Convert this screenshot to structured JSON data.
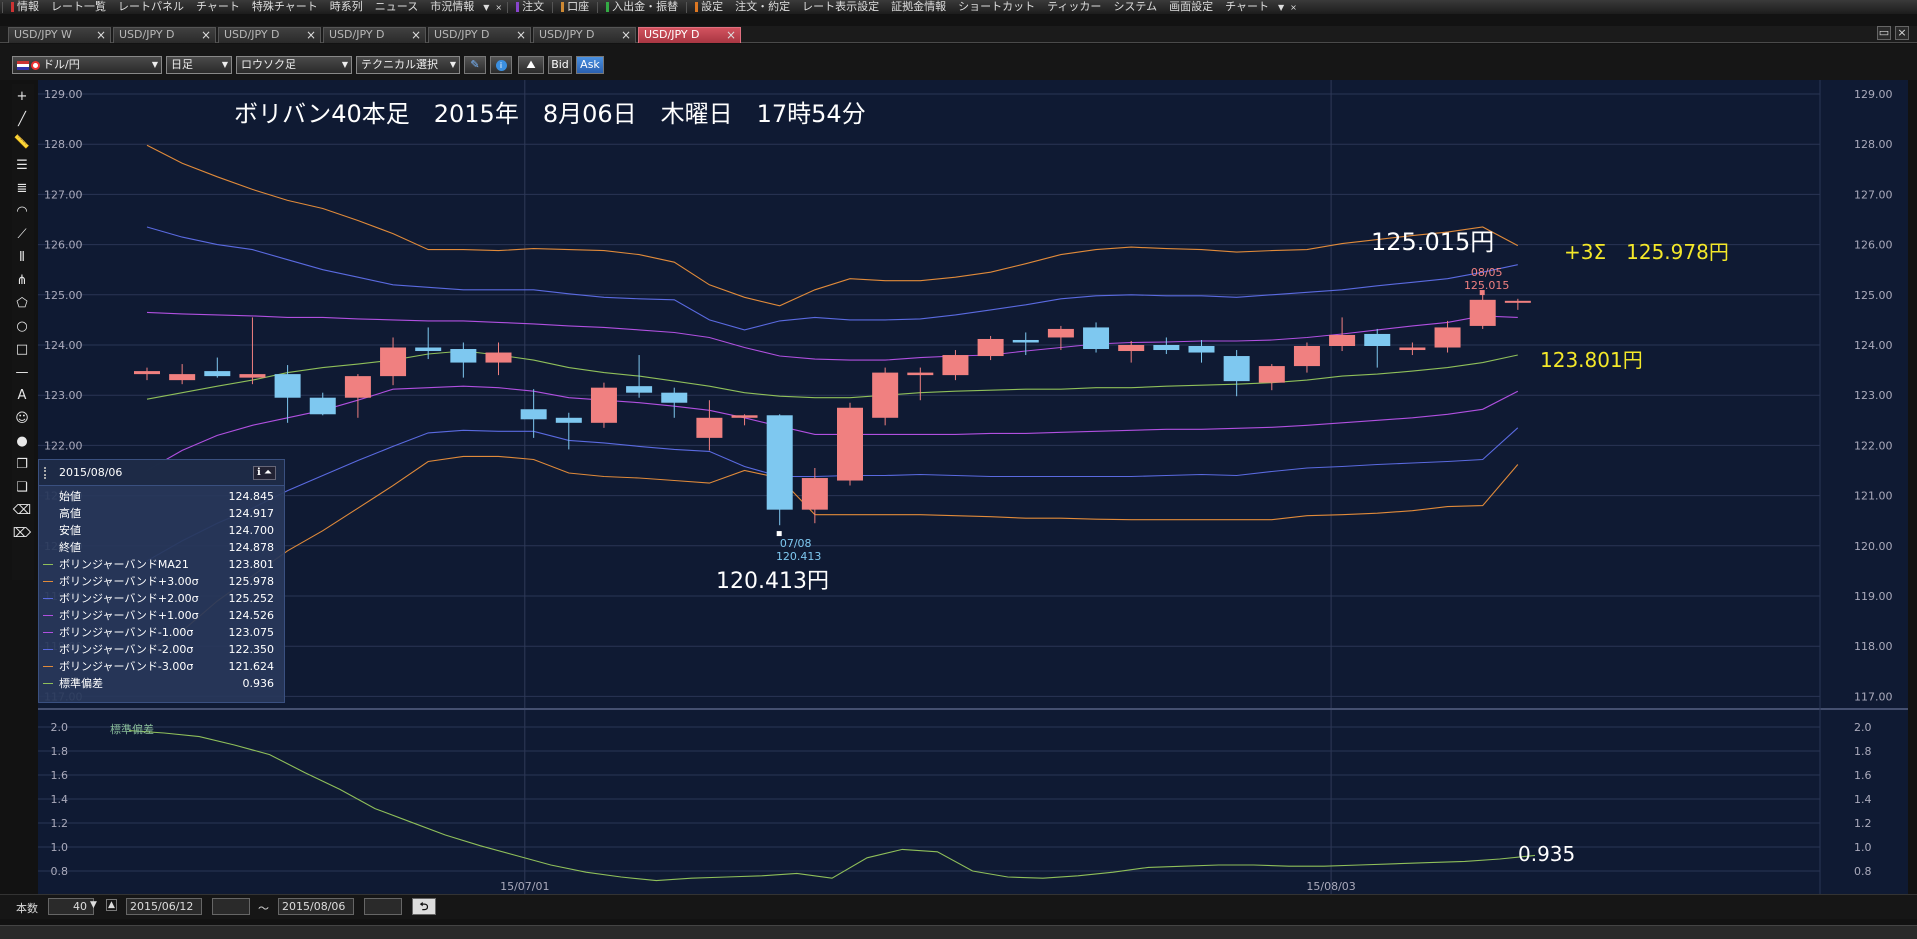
{
  "menu": {
    "items": [
      {
        "label": "情報",
        "mark": "#cc3333"
      },
      {
        "label": "レート一覧"
      },
      {
        "label": "レートパネル"
      },
      {
        "label": "チャート"
      },
      {
        "label": "特殊チャート"
      },
      {
        "label": "時系列"
      },
      {
        "label": "ニュース"
      },
      {
        "label": "市況情報"
      },
      {
        "label": "注文",
        "mark": "#8844cc"
      },
      {
        "label": "口座",
        "mark": "#cc8833"
      },
      {
        "label": "入出金・振替",
        "mark": "#33aa44"
      },
      {
        "label": "設定",
        "mark": "#dd7722"
      },
      {
        "label": "注文・約定"
      },
      {
        "label": "レート表示設定"
      },
      {
        "label": "証拠金情報"
      },
      {
        "label": "ショートカット"
      },
      {
        "label": "ティッカー"
      },
      {
        "label": "システム"
      },
      {
        "label": "画面設定"
      },
      {
        "label": "チャート"
      }
    ],
    "close_glyph": "×",
    "dropdown_glyph": "▼"
  },
  "tabs": [
    {
      "label": "USD/JPY W"
    },
    {
      "label": "USD/JPY D"
    },
    {
      "label": "USD/JPY D"
    },
    {
      "label": "USD/JPY D"
    },
    {
      "label": "USD/JPY D"
    },
    {
      "label": "USD/JPY D"
    },
    {
      "label": "USD/JPY D",
      "active": true
    }
  ],
  "toolbar": {
    "currency": "ドル/円",
    "period": "日足",
    "chart_type": "ロウソク足",
    "technical": "テクニカル選択",
    "bid": "Bid",
    "ask": "Ask"
  },
  "left_tools": [
    "crosshair-icon",
    "line-icon",
    "ruler-icon",
    "hlines-icon",
    "channel-icon",
    "arc-icon",
    "fan-icon",
    "vlines-icon",
    "pitchfork-icon",
    "pentagon-icon",
    "circle-icon",
    "rectangle-icon",
    "hline-icon",
    "text-icon",
    "emoji-icon",
    "paint-icon",
    "copy-icon",
    "paste-icon",
    "eraser-icon",
    "eraser-all-icon"
  ],
  "annotations": {
    "title": "ボリバン40本足　2015年　8月06日　木曜日　17時54分",
    "high_label": "125.015円",
    "sigma3_label": "+3Σ　125.978円",
    "ma_label": "123.801円",
    "low_label": "120.413円",
    "stddev_label": "0.935",
    "low_marker_date": "07/08",
    "low_marker_price": "120.413",
    "high_marker_date": "08/05",
    "high_marker_price": "125.015",
    "lower_pane_title": "標準偏差"
  },
  "infopanel": {
    "date": "2015/08/06",
    "rows": [
      {
        "label": "始値",
        "value": "124.845"
      },
      {
        "label": "高値",
        "value": "124.917"
      },
      {
        "label": "安値",
        "value": "124.700"
      },
      {
        "label": "終値",
        "value": "124.878"
      },
      {
        "label": "ボリンジャーバンドMA21",
        "value": "123.801",
        "color": "#8fbf5a"
      },
      {
        "label": "ボリンジャーバンド+3.00σ",
        "value": "125.978",
        "color": "#e08a3a"
      },
      {
        "label": "ボリンジャーバンド+2.00σ",
        "value": "125.252",
        "color": "#5a6ae0"
      },
      {
        "label": "ボリンジャーバンド+1.00σ",
        "value": "124.526",
        "color": "#b050e0"
      },
      {
        "label": "ボリンジャーバンド-1.00σ",
        "value": "123.075",
        "color": "#b050e0"
      },
      {
        "label": "ボリンジャーバンド-2.00σ",
        "value": "122.350",
        "color": "#5a6ae0"
      },
      {
        "label": "ボリンジャーバンド-3.00σ",
        "value": "121.624",
        "color": "#e08a3a"
      },
      {
        "label": "標準偏差",
        "value": "0.936",
        "color": "#8fbf5a"
      }
    ]
  },
  "bottombar": {
    "count_label": "本数",
    "count_value": "40",
    "from_date": "2015/06/12",
    "tilde": "～",
    "to_date": "2015/08/06"
  },
  "colors": {
    "bull": "#f08080",
    "bear": "#7ec8f0",
    "ma": "#8fbf5a",
    "sigma1": "#b050e0",
    "sigma2": "#5a6ae0",
    "sigma3": "#e08a3a",
    "stddev": "#8fbf5a",
    "chart_bg": "#0f1a33"
  },
  "chart_data": {
    "type": "candlestick",
    "ylim": [
      117,
      129
    ],
    "y_ticks": [
      "129.00",
      "128.00",
      "127.00",
      "126.00",
      "125.00",
      "124.00",
      "123.00",
      "122.00",
      "121.00",
      "120.00",
      "119.00",
      "118.00",
      "117.00"
    ],
    "x_ticks": [
      {
        "label": "15/07/01",
        "index": 12
      },
      {
        "label": "15/08/03",
        "index": 34
      }
    ],
    "candles": [
      {
        "o": 123.42,
        "h": 123.55,
        "l": 123.3,
        "c": 123.48
      },
      {
        "o": 123.3,
        "h": 123.62,
        "l": 123.22,
        "c": 123.42
      },
      {
        "o": 123.48,
        "h": 123.75,
        "l": 123.35,
        "c": 123.38
      },
      {
        "o": 123.35,
        "h": 124.55,
        "l": 123.22,
        "c": 123.42
      },
      {
        "o": 123.42,
        "h": 123.6,
        "l": 122.45,
        "c": 122.95
      },
      {
        "o": 122.95,
        "h": 123.05,
        "l": 122.6,
        "c": 122.62
      },
      {
        "o": 122.95,
        "h": 123.42,
        "l": 122.55,
        "c": 123.38
      },
      {
        "o": 123.38,
        "h": 124.15,
        "l": 123.2,
        "c": 123.95
      },
      {
        "o": 123.95,
        "h": 124.35,
        "l": 123.72,
        "c": 123.88
      },
      {
        "o": 123.92,
        "h": 124.05,
        "l": 123.35,
        "c": 123.65
      },
      {
        "o": 123.65,
        "h": 124.05,
        "l": 123.4,
        "c": 123.85
      },
      {
        "o": 122.72,
        "h": 123.12,
        "l": 122.15,
        "c": 122.52
      },
      {
        "o": 122.55,
        "h": 122.65,
        "l": 121.92,
        "c": 122.45
      },
      {
        "o": 122.45,
        "h": 123.25,
        "l": 122.35,
        "c": 123.15
      },
      {
        "o": 123.18,
        "h": 123.8,
        "l": 122.95,
        "c": 123.05
      },
      {
        "o": 123.05,
        "h": 123.15,
        "l": 122.55,
        "c": 122.85
      },
      {
        "o": 122.15,
        "h": 122.9,
        "l": 121.9,
        "c": 122.55
      },
      {
        "o": 122.55,
        "h": 122.62,
        "l": 122.4,
        "c": 122.6
      },
      {
        "o": 122.6,
        "h": 122.62,
        "l": 120.41,
        "c": 120.72
      },
      {
        "o": 120.72,
        "h": 121.55,
        "l": 120.45,
        "c": 121.35
      },
      {
        "o": 121.3,
        "h": 122.85,
        "l": 121.2,
        "c": 122.75
      },
      {
        "o": 122.55,
        "h": 123.55,
        "l": 122.4,
        "c": 123.45
      },
      {
        "o": 123.4,
        "h": 123.55,
        "l": 122.9,
        "c": 123.45
      },
      {
        "o": 123.4,
        "h": 123.9,
        "l": 123.3,
        "c": 123.8
      },
      {
        "o": 123.78,
        "h": 124.18,
        "l": 123.7,
        "c": 124.12
      },
      {
        "o": 124.1,
        "h": 124.25,
        "l": 123.8,
        "c": 124.05
      },
      {
        "o": 124.15,
        "h": 124.38,
        "l": 123.9,
        "c": 124.32
      },
      {
        "o": 124.35,
        "h": 124.45,
        "l": 123.85,
        "c": 123.92
      },
      {
        "o": 123.88,
        "h": 124.08,
        "l": 123.65,
        "c": 124.0
      },
      {
        "o": 124.0,
        "h": 124.15,
        "l": 123.82,
        "c": 123.9
      },
      {
        "o": 123.98,
        "h": 124.1,
        "l": 123.65,
        "c": 123.85
      },
      {
        "o": 123.78,
        "h": 123.9,
        "l": 122.98,
        "c": 123.28
      },
      {
        "o": 123.25,
        "h": 123.62,
        "l": 123.1,
        "c": 123.58
      },
      {
        "o": 123.58,
        "h": 124.05,
        "l": 123.45,
        "c": 123.98
      },
      {
        "o": 123.98,
        "h": 124.55,
        "l": 123.88,
        "c": 124.2
      },
      {
        "o": 124.22,
        "h": 124.32,
        "l": 123.55,
        "c": 123.98
      },
      {
        "o": 123.9,
        "h": 124.05,
        "l": 123.8,
        "c": 123.95
      },
      {
        "o": 123.95,
        "h": 124.48,
        "l": 123.85,
        "c": 124.35
      },
      {
        "o": 124.38,
        "h": 125.02,
        "l": 124.32,
        "c": 124.9
      },
      {
        "o": 124.85,
        "h": 124.92,
        "l": 124.7,
        "c": 124.88
      }
    ],
    "bands": {
      "ma": [
        122.92,
        123.05,
        123.18,
        123.3,
        123.45,
        123.55,
        123.62,
        123.7,
        123.82,
        123.88,
        123.8,
        123.7,
        123.55,
        123.45,
        123.38,
        123.28,
        123.18,
        123.05,
        122.98,
        122.95,
        122.95,
        123.0,
        123.05,
        123.08,
        123.1,
        123.12,
        123.12,
        123.15,
        123.15,
        123.18,
        123.2,
        123.22,
        123.25,
        123.3,
        123.38,
        123.42,
        123.48,
        123.55,
        123.65,
        123.8
      ],
      "p3": [
        127.98,
        127.62,
        127.35,
        127.1,
        126.88,
        126.72,
        126.48,
        126.22,
        125.9,
        125.9,
        125.88,
        125.92,
        125.9,
        125.88,
        125.8,
        125.65,
        125.2,
        124.95,
        124.78,
        125.1,
        125.32,
        125.28,
        125.28,
        125.35,
        125.45,
        125.62,
        125.8,
        125.9,
        125.95,
        125.92,
        125.9,
        125.85,
        125.88,
        125.9,
        126.02,
        126.1,
        126.18,
        126.25,
        126.35,
        125.98
      ],
      "p2": [
        126.35,
        126.15,
        126.0,
        125.9,
        125.7,
        125.5,
        125.35,
        125.2,
        125.15,
        125.1,
        125.1,
        125.1,
        125.02,
        124.95,
        124.92,
        124.9,
        124.5,
        124.3,
        124.48,
        124.55,
        124.5,
        124.5,
        124.52,
        124.6,
        124.7,
        124.8,
        124.92,
        124.98,
        125.0,
        124.98,
        124.98,
        124.95,
        125.0,
        125.05,
        125.1,
        125.18,
        125.25,
        125.32,
        125.45,
        125.6
      ],
      "p1": [
        124.65,
        124.62,
        124.6,
        124.58,
        124.55,
        124.55,
        124.52,
        124.5,
        124.48,
        124.48,
        124.45,
        124.42,
        124.38,
        124.35,
        124.3,
        124.25,
        124.15,
        123.95,
        123.78,
        123.72,
        123.7,
        123.7,
        123.75,
        123.78,
        123.8,
        123.88,
        123.95,
        124.02,
        124.05,
        124.06,
        124.08,
        124.08,
        124.1,
        124.15,
        124.22,
        124.3,
        124.38,
        124.45,
        124.58,
        124.55
      ],
      "m1": [
        121.5,
        121.9,
        122.2,
        122.4,
        122.55,
        122.7,
        122.9,
        123.12,
        123.15,
        123.18,
        123.15,
        123.08,
        122.95,
        122.9,
        122.85,
        122.78,
        122.7,
        122.55,
        122.38,
        122.22,
        122.22,
        122.22,
        122.22,
        122.22,
        122.24,
        122.24,
        122.26,
        122.28,
        122.3,
        122.32,
        122.32,
        122.34,
        122.36,
        122.4,
        122.45,
        122.5,
        122.55,
        122.62,
        122.72,
        123.08
      ],
      "m2": [
        119.7,
        120.1,
        120.45,
        120.75,
        121.1,
        121.4,
        121.7,
        121.98,
        122.25,
        122.3,
        122.28,
        122.28,
        122.1,
        122.05,
        121.98,
        121.92,
        121.88,
        121.58,
        121.38,
        121.38,
        121.4,
        121.4,
        121.42,
        121.4,
        121.38,
        121.38,
        121.38,
        121.38,
        121.38,
        121.4,
        121.42,
        121.4,
        121.48,
        121.55,
        121.58,
        121.62,
        121.65,
        121.68,
        121.72,
        122.35
      ],
      "m3": [
        117.9,
        118.3,
        118.9,
        119.4,
        119.9,
        120.3,
        120.75,
        121.2,
        121.68,
        121.78,
        121.78,
        121.72,
        121.45,
        121.38,
        121.35,
        121.3,
        121.25,
        121.5,
        121.35,
        120.62,
        120.62,
        120.62,
        120.62,
        120.6,
        120.58,
        120.55,
        120.55,
        120.53,
        120.52,
        120.52,
        120.52,
        120.52,
        120.52,
        120.6,
        120.62,
        120.65,
        120.7,
        120.78,
        120.8,
        121.62
      ]
    },
    "stddev": {
      "ylim": [
        0.7,
        2.0
      ],
      "y_ticks": [
        "2.0",
        "1.8",
        "1.6",
        "1.4",
        "1.2",
        "1.0",
        "0.8"
      ],
      "values": [
        1.97,
        1.95,
        1.92,
        1.85,
        1.77,
        1.62,
        1.48,
        1.32,
        1.21,
        1.1,
        1.01,
        0.93,
        0.85,
        0.79,
        0.75,
        0.72,
        0.74,
        0.75,
        0.76,
        0.78,
        0.74,
        0.91,
        0.98,
        0.96,
        0.8,
        0.75,
        0.74,
        0.76,
        0.79,
        0.83,
        0.84,
        0.85,
        0.85,
        0.84,
        0.84,
        0.85,
        0.86,
        0.87,
        0.88,
        0.9,
        0.93
      ]
    }
  }
}
